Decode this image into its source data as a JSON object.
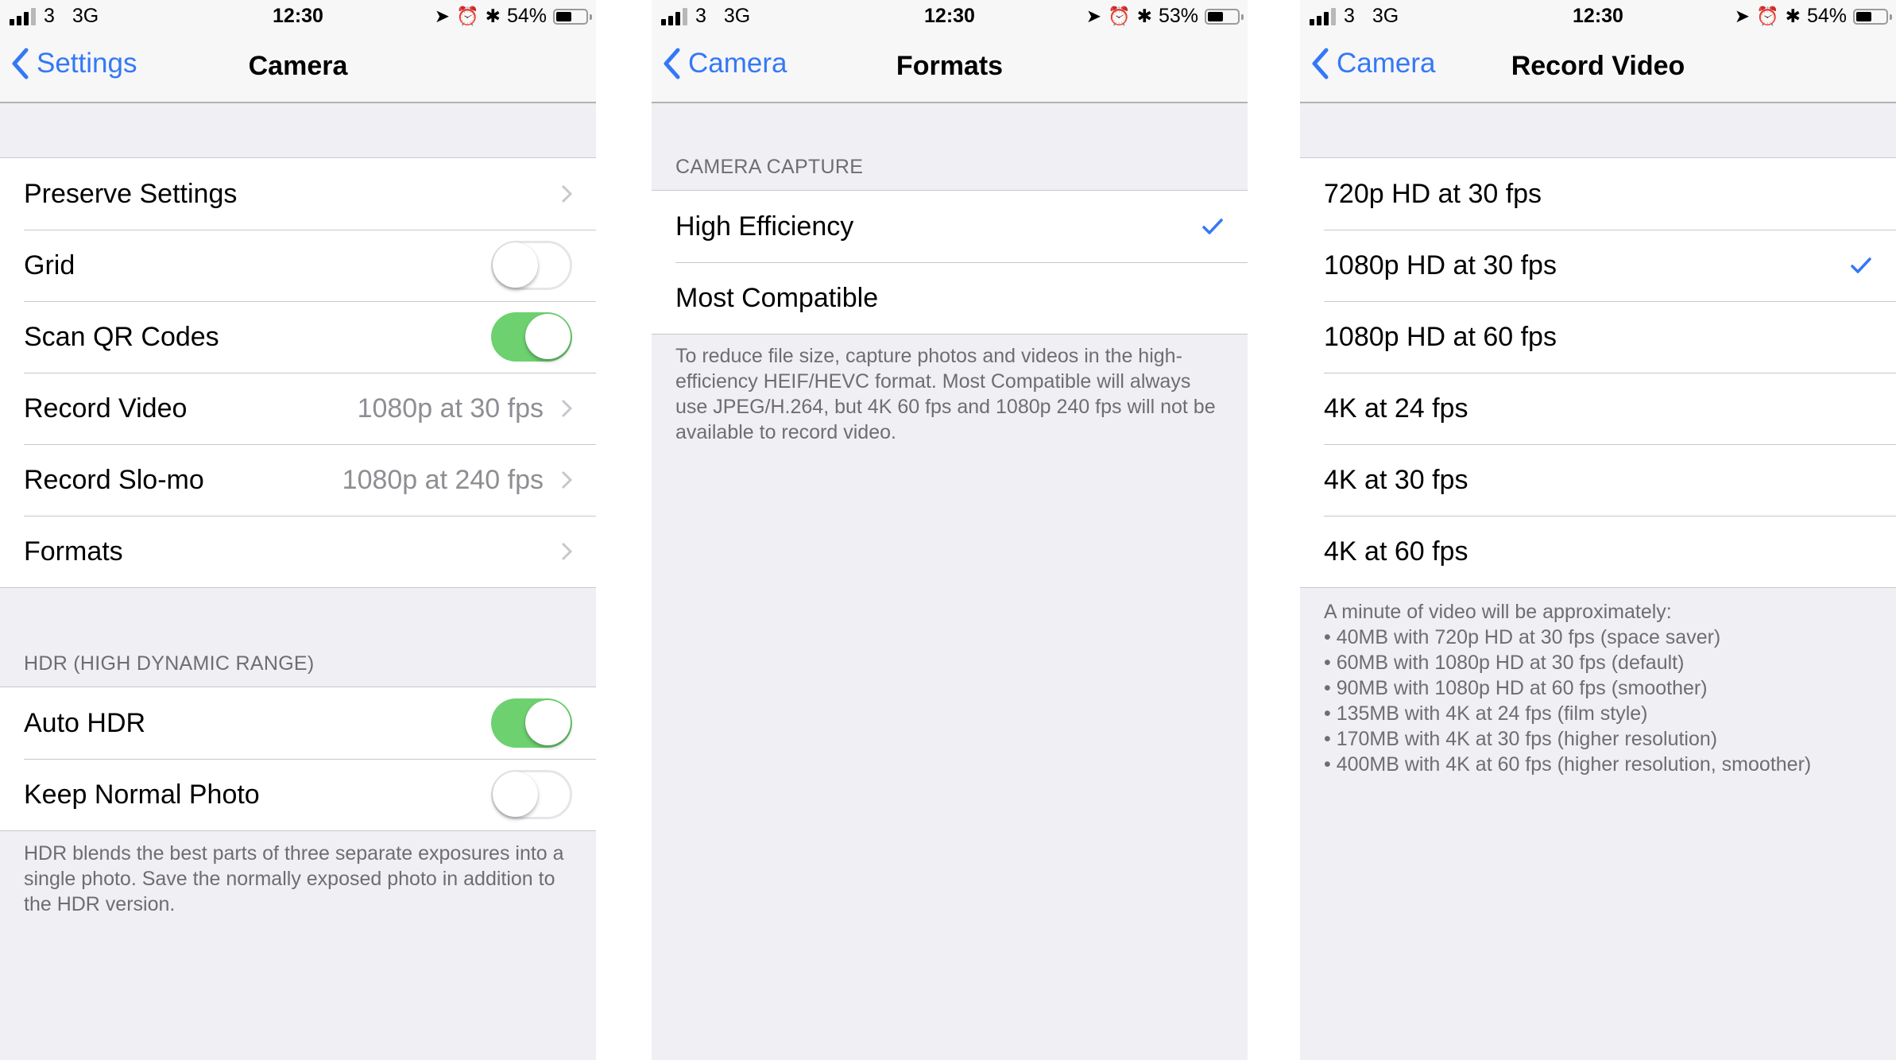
{
  "colors": {
    "accent": "#3478f6",
    "toggle_on": "#6dd170",
    "group_bg": "#efeff4"
  },
  "panels": [
    {
      "status": {
        "signal_bars": 3,
        "carrier": "3",
        "network": "3G",
        "time": "12:30",
        "battery": "54%",
        "battery_level": 0.54
      },
      "nav": {
        "back": "Settings",
        "title": "Camera"
      },
      "rows": [
        {
          "label": "Preserve Settings",
          "type": "disclosure"
        },
        {
          "label": "Grid",
          "type": "toggle",
          "on": false
        },
        {
          "label": "Scan QR Codes",
          "type": "toggle",
          "on": true
        },
        {
          "label": "Record Video",
          "value": "1080p at 30 fps",
          "type": "disclosure"
        },
        {
          "label": "Record Slo-mo",
          "value": "1080p at 240 fps",
          "type": "disclosure"
        },
        {
          "label": "Formats",
          "type": "disclosure"
        }
      ],
      "hdr_header": "HDR (HIGH DYNAMIC RANGE)",
      "hdr_rows": [
        {
          "label": "Auto HDR",
          "type": "toggle",
          "on": true
        },
        {
          "label": "Keep Normal Photo",
          "type": "toggle",
          "on": false
        }
      ],
      "hdr_footer": "HDR blends the best parts of three separate exposures into a single photo. Save the normally exposed photo in addition to the HDR version."
    },
    {
      "status": {
        "signal_bars": 3,
        "carrier": "3",
        "network": "3G",
        "time": "12:30",
        "battery": "53%",
        "battery_level": 0.53
      },
      "nav": {
        "back": "Camera",
        "title": "Formats"
      },
      "header": "CAMERA CAPTURE",
      "rows": [
        {
          "label": "High Efficiency",
          "selected": true
        },
        {
          "label": "Most Compatible",
          "selected": false
        }
      ],
      "footer": "To reduce file size, capture photos and videos in the high-efficiency HEIF/HEVC format. Most Compatible will always use JPEG/H.264, but 4K 60 fps and 1080p 240 fps will not be available to record video."
    },
    {
      "status": {
        "signal_bars": 3,
        "carrier": "3",
        "network": "3G",
        "time": "12:30",
        "battery": "54%",
        "battery_level": 0.54
      },
      "nav": {
        "back": "Camera",
        "title": "Record Video"
      },
      "rows": [
        {
          "label": "720p HD at 30 fps",
          "selected": false
        },
        {
          "label": "1080p HD at 30 fps",
          "selected": true
        },
        {
          "label": "1080p HD at 60 fps",
          "selected": false
        },
        {
          "label": "4K at 24 fps",
          "selected": false
        },
        {
          "label": "4K at 30 fps",
          "selected": false
        },
        {
          "label": "4K at 60 fps",
          "selected": false
        }
      ],
      "footer_title": "A minute of video will be approximately:",
      "footer_items": [
        "• 40MB with 720p HD at 30 fps (space saver)",
        "• 60MB with 1080p HD at 30 fps (default)",
        "• 90MB with 1080p HD at 60 fps (smoother)",
        "• 135MB with 4K at 24 fps (film style)",
        "• 170MB with 4K at 30 fps (higher resolution)",
        "• 400MB with 4K at 60 fps (higher resolution, smoother)"
      ]
    }
  ]
}
